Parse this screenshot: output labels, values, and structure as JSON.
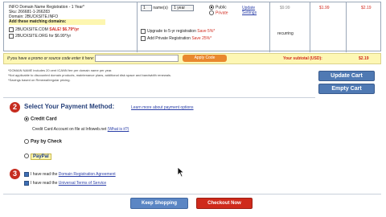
{
  "cart": {
    "item_name": "INFO Domain Name Registration - 1 Year*",
    "sku": "Sku: 266681-1-266283",
    "domain_line": "Domain:   2BUCKSITE.INFO",
    "matching_label": "Add these matching domains:",
    "matching_domains": [
      {
        "name": "2BUCKSITE.COM",
        "sale": "SALE! $6.79*/yr"
      },
      {
        "name": "2BUCKSITE.ORG",
        "sale": "for $6.99*/yr"
      }
    ],
    "names_select": "1",
    "names_label": "name(s)",
    "term_select": "1 year",
    "privacy_public": "Public",
    "privacy_private": "Private",
    "privacy_link": "Update Settings",
    "upsell_1": "Upgrade to 5-yr registration",
    "upsell_1_save": "Save 5%*",
    "upsell_2": "Add Private Registration",
    "upsell_2_save": "Save 25%*",
    "col_price": "$9.99",
    "col_sale": "$1.99",
    "col_total": "$2.19",
    "recurring": "recurring"
  },
  "promo": {
    "prompt": "If you have a promo or source code enter it here:",
    "apply_label": "Apply Code",
    "subtotal_label": "Your subtotal (USD):",
    "subtotal_value": "$2.19"
  },
  "notes": {
    "line1": "*DOMAIN NAME includes 20 cent ICANN fee per domain name per year.",
    "line2": "*Not applicable to discounted domain products, maintenance plans, additional disk space and bandwidth renewals.",
    "line3": "*Savings based on Renewal/regular pricing."
  },
  "buttons": {
    "update_cart": "Update Cart",
    "empty_cart": "Empty Cart",
    "keep_shopping": "Keep Shopping",
    "checkout_now": "Checkout Now"
  },
  "payment": {
    "step_number": "2",
    "heading": "Select Your Payment Method:",
    "more_info_link": "Learn more about payment options",
    "options": [
      {
        "label": "Credit Card",
        "selected": true
      },
      {
        "label": "Pay by Check",
        "selected": false
      },
      {
        "label": "PayPal",
        "selected": false
      }
    ],
    "credit_card_note": "Credit Card Account on file at Infoweb.net",
    "credit_card_link": "(What is it?)"
  },
  "agreements": {
    "step_number": "3",
    "items": [
      {
        "prefix": "I have read the ",
        "link": "Domain Registration Agreement"
      },
      {
        "prefix": "I have read the ",
        "link": "Universal Terms of Service"
      }
    ]
  },
  "colors": {
    "accent_red": "#c62c1f",
    "button_blue": "#4f79b3",
    "promo_yellow": "#fdf7b4",
    "apply_orange": "#e9882e"
  }
}
